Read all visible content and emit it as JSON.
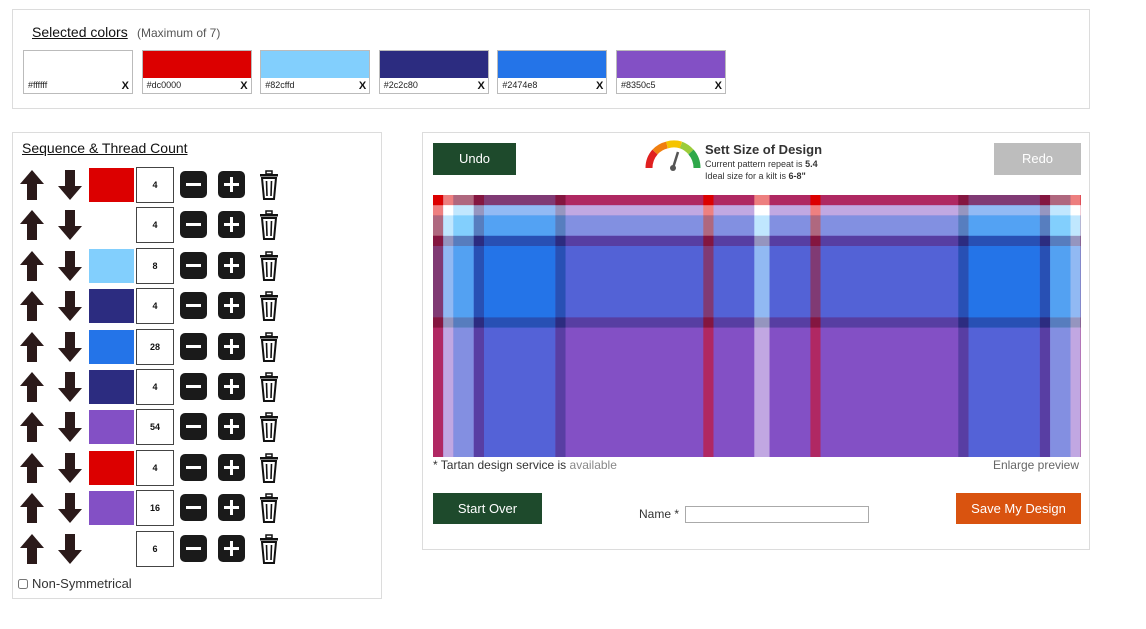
{
  "selected_colors": {
    "title": "Selected colors",
    "max_note": "(Maximum of 7)",
    "remove_label": "X",
    "items": [
      {
        "hex": "#ffffff",
        "label": "#ffffff"
      },
      {
        "hex": "#dc0000",
        "label": "#dc0000"
      },
      {
        "hex": "#82cffd",
        "label": "#82cffd"
      },
      {
        "hex": "#2c2c80",
        "label": "#2c2c80"
      },
      {
        "hex": "#2474e8",
        "label": "#2474e8"
      },
      {
        "hex": "#8350c5",
        "label": "#8350c5"
      }
    ]
  },
  "sequence": {
    "title": "Sequence & Thread Count",
    "rows": [
      {
        "color": "#dc0000",
        "count": "4"
      },
      {
        "color": "#ffffff",
        "count": "4"
      },
      {
        "color": "#82cffd",
        "count": "8"
      },
      {
        "color": "#2c2c80",
        "count": "4"
      },
      {
        "color": "#2474e8",
        "count": "28"
      },
      {
        "color": "#2c2c80",
        "count": "4"
      },
      {
        "color": "#8350c5",
        "count": "54"
      },
      {
        "color": "#dc0000",
        "count": "4"
      },
      {
        "color": "#8350c5",
        "count": "16"
      },
      {
        "color": "#ffffff",
        "count": "6"
      }
    ],
    "non_symmetrical_label": "Non-Symmetrical",
    "non_symmetrical_checked": false
  },
  "design": {
    "undo_label": "Undo",
    "redo_label": "Redo",
    "sett_title": "Sett Size of Design",
    "repeat_text": "Current pattern repeat is ",
    "repeat_value": "5.4",
    "ideal_text": "Ideal size for a kilt is ",
    "ideal_value": "6-8\"",
    "service_text": "* Tartan design service is ",
    "service_status": "available",
    "enlarge_label": "Enlarge preview",
    "start_over_label": "Start Over",
    "name_label": "Name *",
    "name_value": "",
    "save_label": "Save My Design"
  },
  "icons": [
    "arrow-up-icon",
    "arrow-down-icon",
    "minus-icon",
    "plus-icon",
    "trash-icon",
    "gauge-icon"
  ]
}
